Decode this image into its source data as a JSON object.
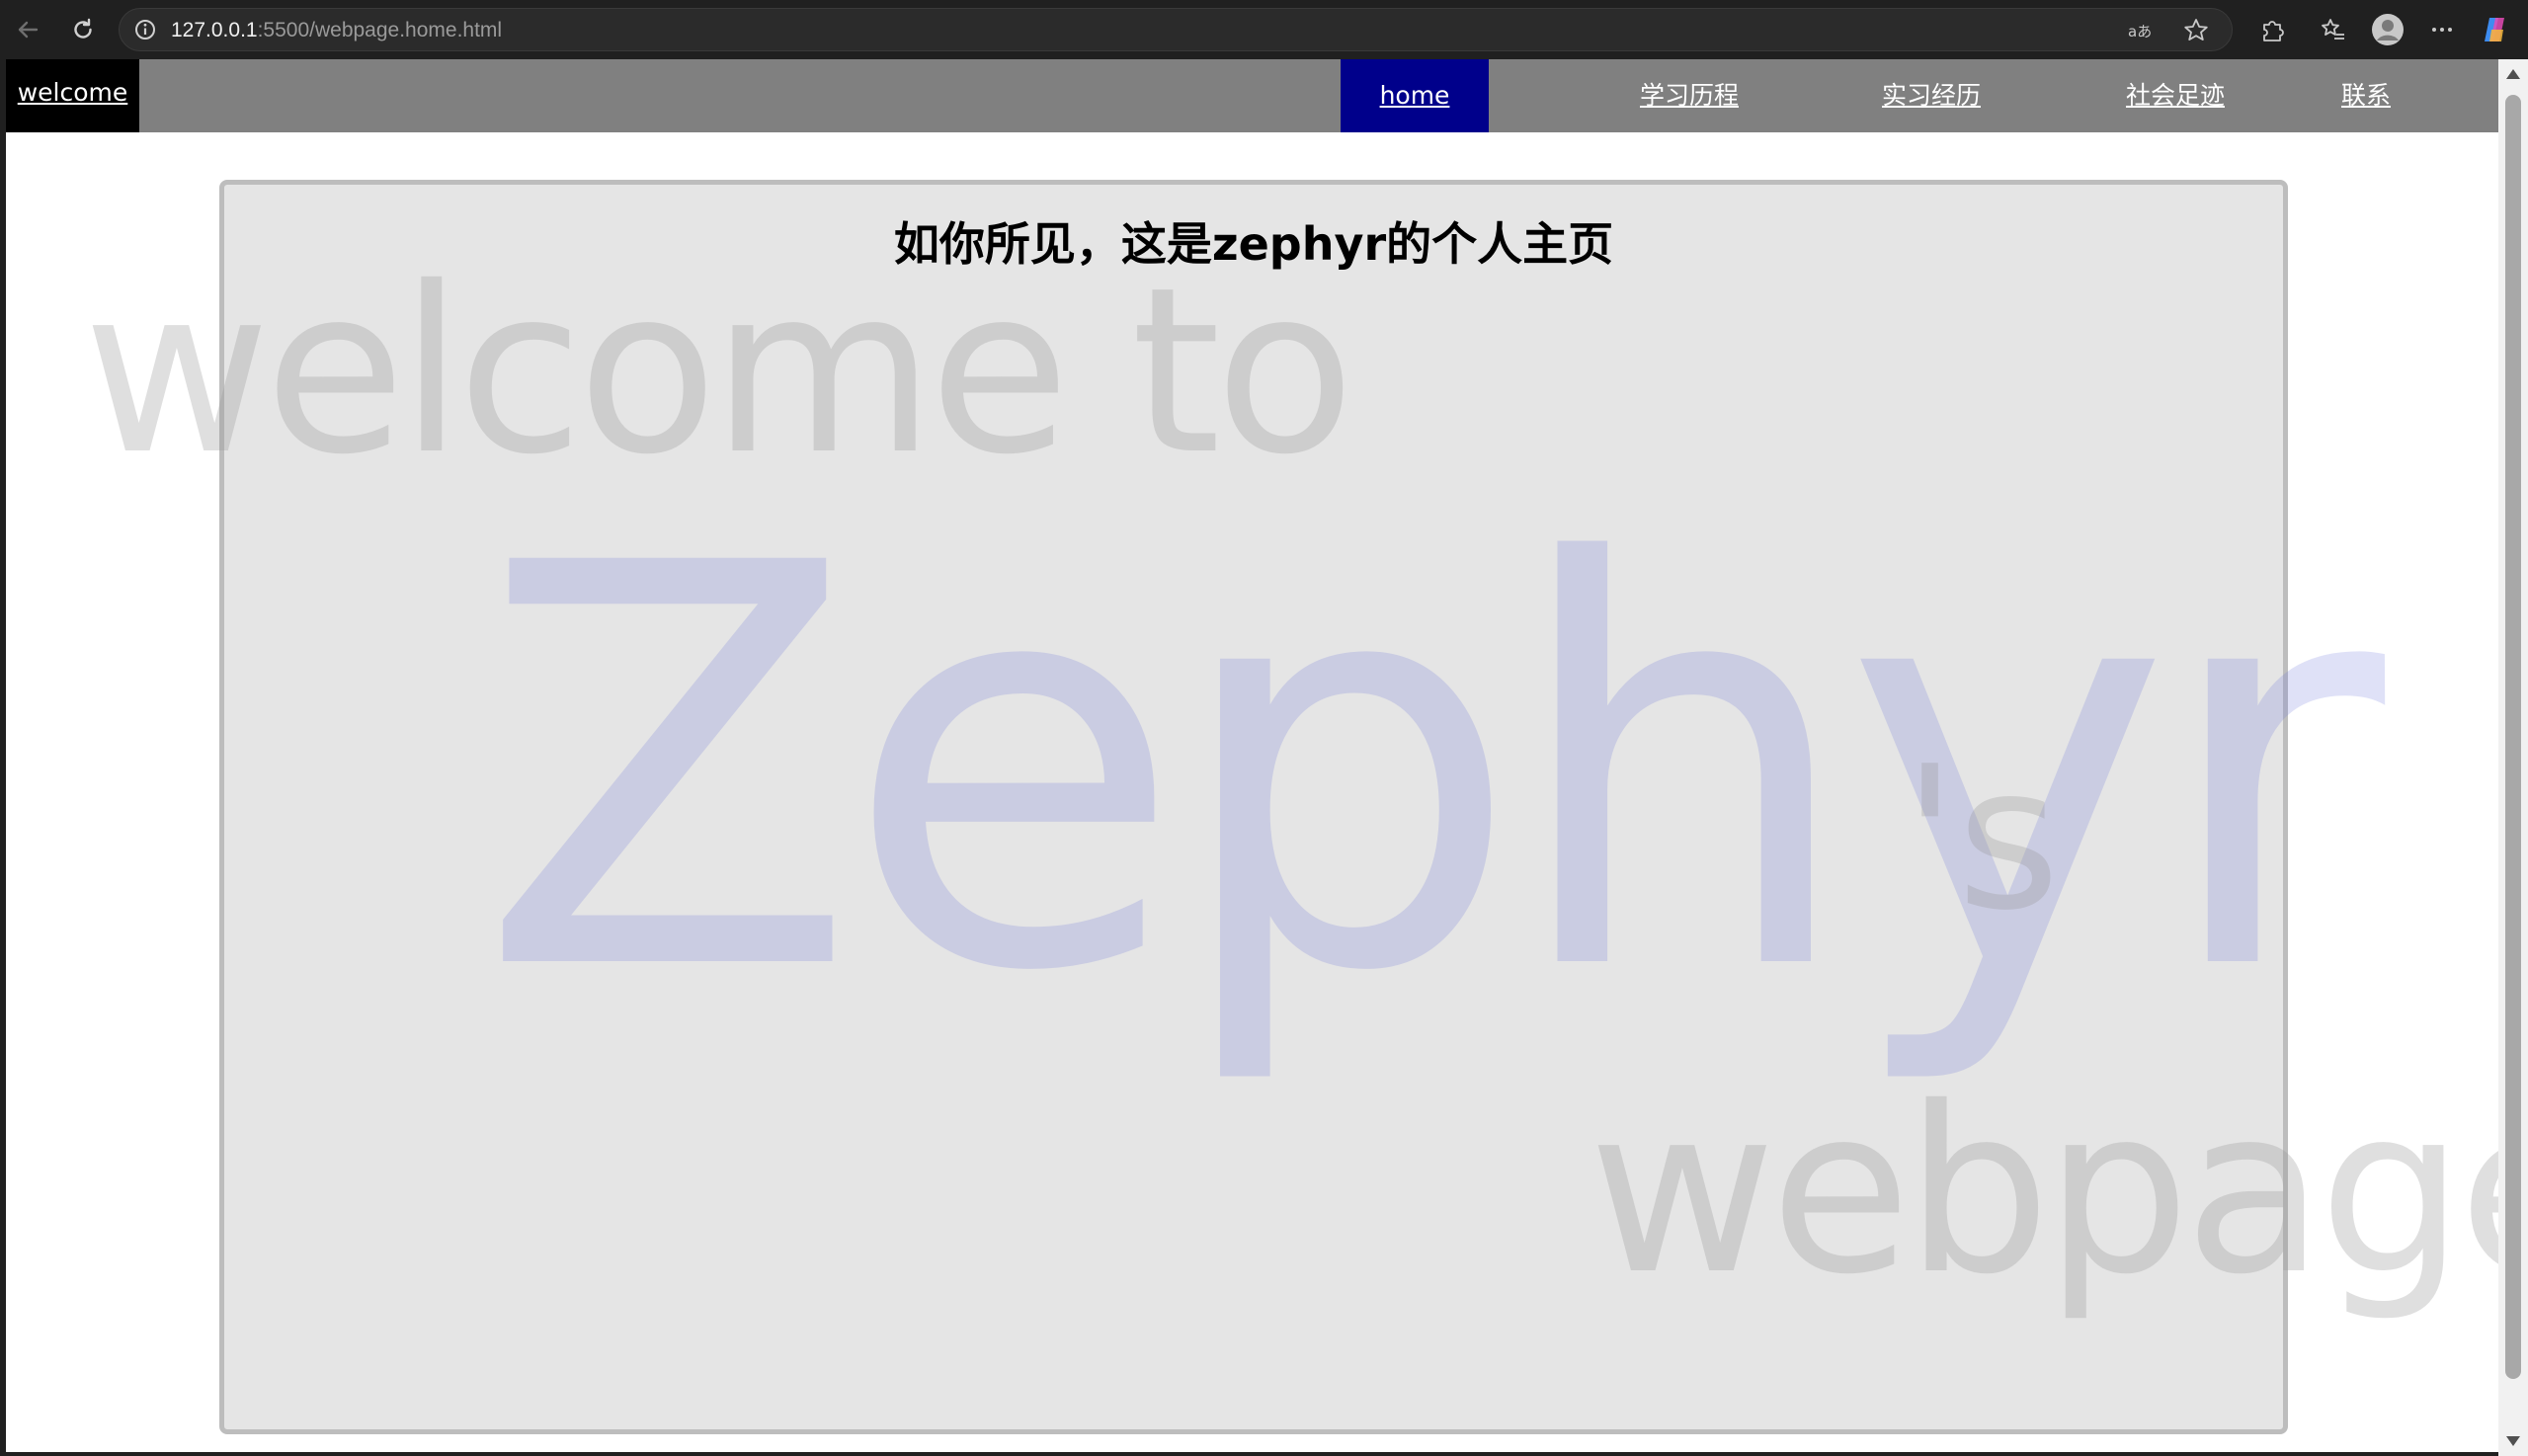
{
  "browser": {
    "url_host": "127.0.0.1",
    "url_path": ":5500/webpage.home.html"
  },
  "nav": {
    "brand": "welcome",
    "items": [
      {
        "label": "home",
        "active": true
      },
      {
        "label": "学习历程",
        "active": false
      },
      {
        "label": "实习经历",
        "active": false
      },
      {
        "label": "社会足迹",
        "active": false
      },
      {
        "label": "联系",
        "active": false
      }
    ],
    "colors": {
      "bar": "#808080",
      "brand_bg": "#000000",
      "active_bg": "#00008b"
    }
  },
  "main": {
    "title": "如你所见，这是zephyr的个人主页",
    "watermark": {
      "line1": "welcome to",
      "name": "Zephyr",
      "possessive": "'s",
      "line3": "webpage"
    }
  }
}
